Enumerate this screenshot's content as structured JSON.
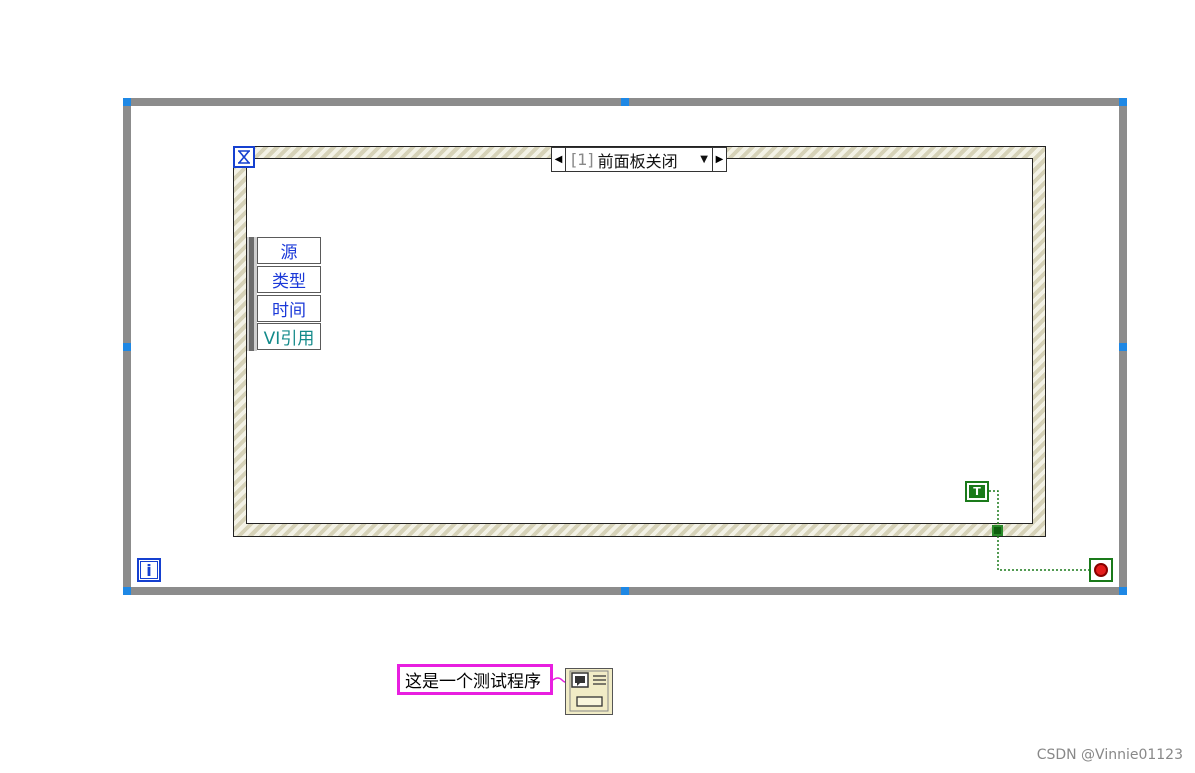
{
  "event_structure": {
    "case_index": "[1]",
    "case_name": "前面板关闭"
  },
  "event_data_node": {
    "items": [
      "源",
      "类型",
      "时间",
      "VI引用"
    ]
  },
  "terminals": {
    "iteration": "i",
    "true_constant": "T"
  },
  "string_constant": {
    "value": "这是一个测试程序"
  },
  "watermark": {
    "text": "CSDN @Vinnie01123"
  },
  "colors": {
    "loop_frame": "#8c8c8c",
    "handle": "#1e88e5",
    "string_wire": "#e81fe0",
    "boolean_wire": "#1a7a1a",
    "event_label_text": "#1a38d8"
  },
  "icons": {
    "event_structure_icon": "hourglass-event-icon",
    "dialog_icon": "one-button-dialog-icon",
    "stop_icon": "stop-condition-icon"
  }
}
